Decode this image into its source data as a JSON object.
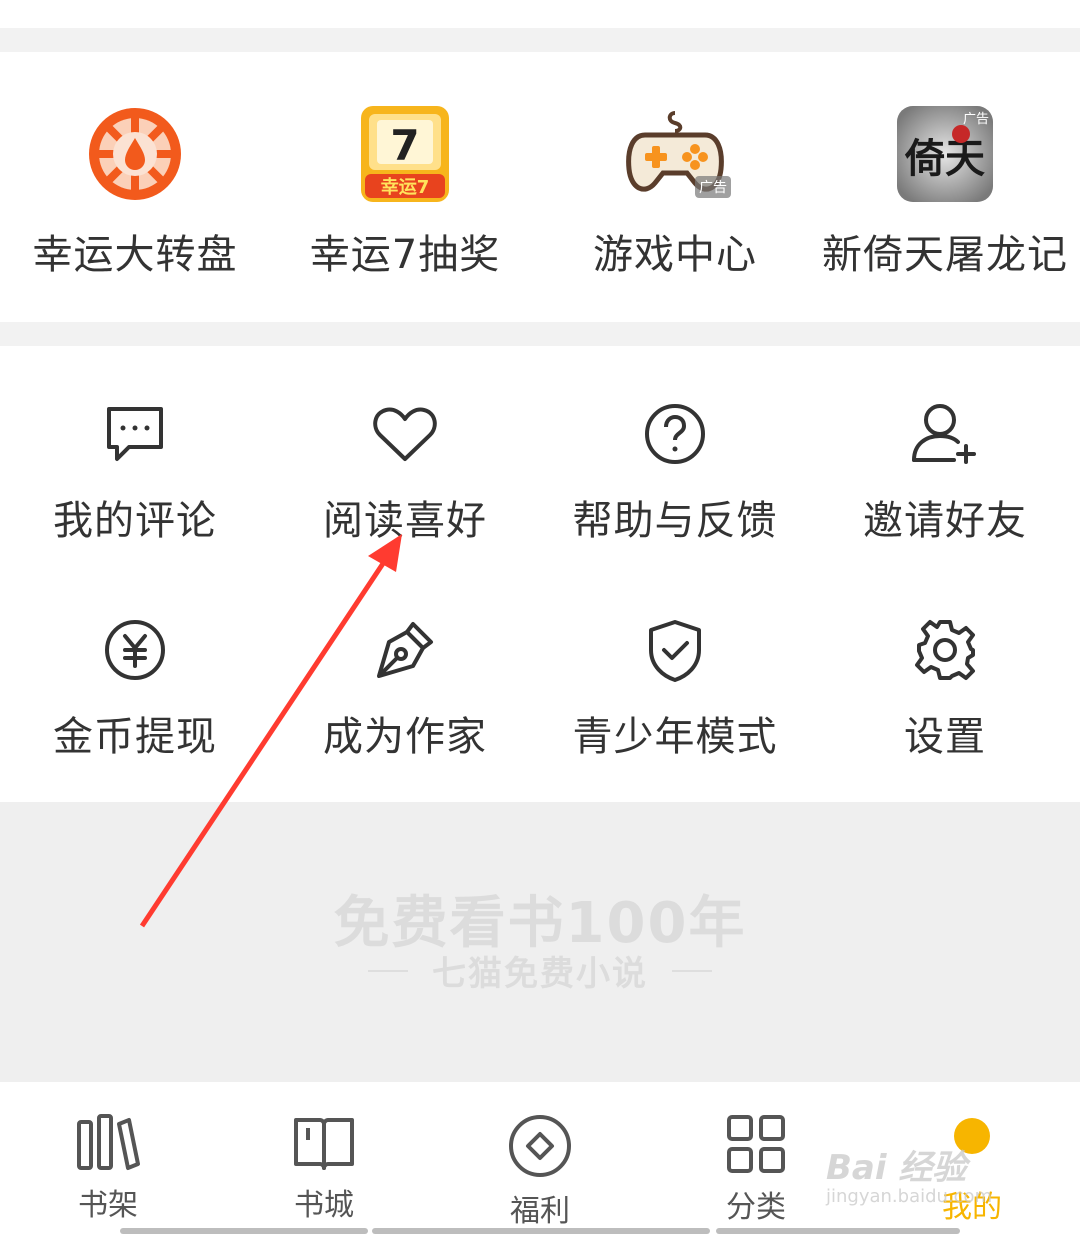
{
  "promo_row": [
    {
      "label": "幸运大转盘",
      "icon": "lucky-wheel-icon"
    },
    {
      "label": "幸运7抽奖",
      "icon": "lucky-7-icon",
      "icon_text": "幸运7",
      "badge_digit": "7"
    },
    {
      "label": "游戏中心",
      "icon": "gamepad-icon",
      "badge": "广告"
    },
    {
      "label": "新倚天屠龙记",
      "icon": "game-ad-icon",
      "icon_text": "倚天",
      "badge": "广告"
    }
  ],
  "tools_row1": [
    {
      "label": "我的评论",
      "icon": "comment-icon"
    },
    {
      "label": "阅读喜好",
      "icon": "heart-icon"
    },
    {
      "label": "帮助与反馈",
      "icon": "help-icon"
    },
    {
      "label": "邀请好友",
      "icon": "add-friend-icon"
    }
  ],
  "tools_row2": [
    {
      "label": "金币提现",
      "icon": "yuan-coin-icon"
    },
    {
      "label": "成为作家",
      "icon": "pen-nib-icon"
    },
    {
      "label": "青少年模式",
      "icon": "shield-check-icon"
    },
    {
      "label": "设置",
      "icon": "gear-icon"
    }
  ],
  "banner": {
    "slogan": "免费看书100年",
    "sub": "七猫免费小说"
  },
  "nav": [
    {
      "label": "书架",
      "icon": "bookshelf-icon",
      "active": false
    },
    {
      "label": "书城",
      "icon": "book-icon",
      "active": false
    },
    {
      "label": "福利",
      "icon": "diamond-circle-icon",
      "active": false
    },
    {
      "label": "分类",
      "icon": "grid-icon",
      "active": false
    },
    {
      "label": "我的",
      "icon": "profile-dot-icon",
      "active": true
    }
  ],
  "watermark": {
    "text": "Bai 经验",
    "url_text": "jingyan.baidu.com"
  },
  "colors": {
    "accent": "#f7b500",
    "wheel": "#f25a1c",
    "arrow": "#ff3b30",
    "icon_stroke": "#333333"
  }
}
